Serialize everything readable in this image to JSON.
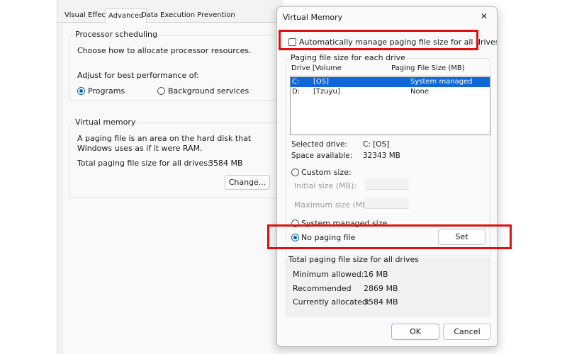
{
  "background_window": {
    "tabs": [
      "Visual Effects",
      "Advanced",
      "Data Execution Prevention"
    ],
    "active_tab": "Advanced",
    "processor_scheduling": {
      "title": "Processor scheduling",
      "description": "Choose how to allocate processor resources.",
      "adjust_label": "Adjust for best performance of:",
      "options": [
        {
          "label": "Programs",
          "selected": true
        },
        {
          "label": "Background services",
          "selected": false
        }
      ]
    },
    "virtual_memory": {
      "title": "Virtual memory",
      "description": "A paging file is an area on the hard disk that Windows uses as if it were RAM.",
      "total_label": "Total paging file size for all drives:",
      "total_value": "3584 MB",
      "change_label": "Change..."
    }
  },
  "dialog": {
    "title": "Virtual Memory",
    "close_glyph": "✕",
    "auto_manage": {
      "label": "Automatically manage paging file size for all drives",
      "checked": false
    },
    "group_title": "Paging file size for each drive",
    "columns": {
      "drive": "Drive  [Volume",
      "size": "Paging File Size (MB)"
    },
    "drives": [
      {
        "letter": "C:",
        "volume": "[OS]",
        "size": "System managed",
        "selected": true
      },
      {
        "letter": "D:",
        "volume": "[Tzuyu]",
        "size": "None",
        "selected": false
      }
    ],
    "selected_drive": {
      "label": "Selected drive:",
      "value": "C:  [OS]"
    },
    "space_available": {
      "label": "Space available:",
      "value": "32343 MB"
    },
    "custom_size": {
      "label": "Custom size:",
      "selected": false
    },
    "initial_size": {
      "label": "Initial size (MB):",
      "value": ""
    },
    "maximum_size": {
      "label": "Maximum size (MB):",
      "value": ""
    },
    "system_managed": {
      "label": "System managed size",
      "selected": false
    },
    "no_paging": {
      "label": "No paging file",
      "selected": true
    },
    "set_label": "Set",
    "totals": {
      "title": "Total paging file size for all drives",
      "minimum": {
        "label": "Minimum allowed:",
        "value": "16 MB"
      },
      "recommended": {
        "label": "Recommended",
        "value": "2869 MB"
      },
      "allocated": {
        "label": "Currently allocated:",
        "value": "3584 MB"
      }
    },
    "ok_label": "OK",
    "cancel_label": "Cancel"
  },
  "colors": {
    "highlight": "#e01010",
    "selection": "#0f67d8",
    "accent": "#005fb8"
  }
}
